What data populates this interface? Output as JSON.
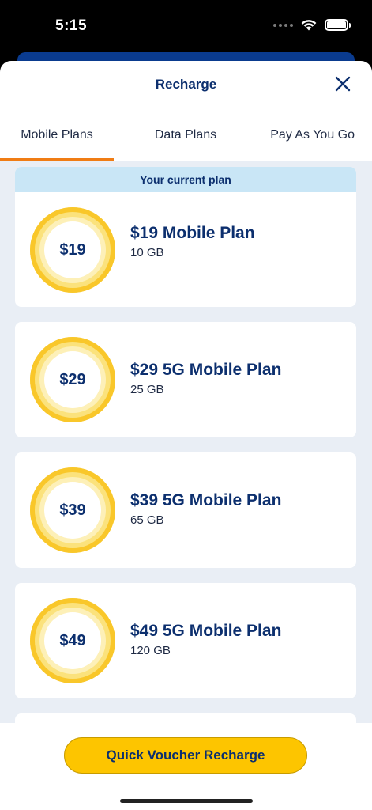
{
  "status": {
    "time": "5:15"
  },
  "sheet": {
    "title": "Recharge"
  },
  "tabs": [
    {
      "label": "Mobile Plans",
      "active": true
    },
    {
      "label": "Data Plans",
      "active": false
    },
    {
      "label": "Pay As You Go",
      "active": false
    }
  ],
  "current_plan_banner": "Your current plan",
  "plans": [
    {
      "price": "$19",
      "name": "$19 Mobile Plan",
      "data": "10 GB"
    },
    {
      "price": "$29",
      "name": "$29 5G Mobile Plan",
      "data": "25 GB"
    },
    {
      "price": "$39",
      "name": "$39 5G Mobile Plan",
      "data": "65 GB"
    },
    {
      "price": "$49",
      "name": "$49 5G Mobile Plan",
      "data": "120 GB"
    }
  ],
  "footer": {
    "quick_button_label": "Quick Voucher Recharge"
  },
  "colors": {
    "navy": "#0c2f6e",
    "accent_orange": "#f07c14",
    "button_yellow": "#fdc500",
    "banner_blue": "#c9e6f6"
  },
  "icons": {
    "close": "close-icon",
    "wifi": "wifi-icon",
    "battery": "battery-icon"
  }
}
